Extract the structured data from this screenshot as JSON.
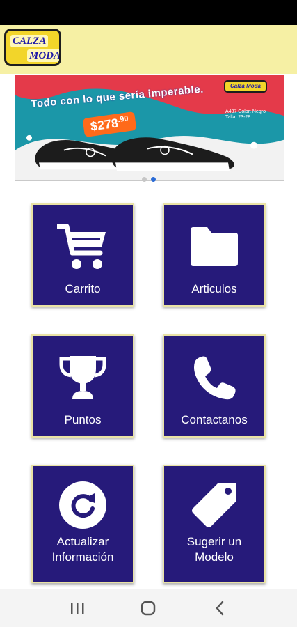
{
  "header": {
    "logo_line1": "CALZA",
    "logo_line2": "MODA"
  },
  "banner": {
    "headline": "Todo con lo que sería imperable.",
    "price_prefix": "Desde",
    "price": "$278",
    "price_cents": ".90",
    "mini_logo": "Calza Moda",
    "specs": "A437 Color: Negro Talla: 23-28",
    "slide_count": 2,
    "active_slide": 2
  },
  "tiles": [
    {
      "label": "Carrito",
      "icon": "cart-icon"
    },
    {
      "label": "Articulos",
      "icon": "folder-icon"
    },
    {
      "label": "Puntos",
      "icon": "trophy-icon"
    },
    {
      "label": "Contactanos",
      "icon": "phone-icon"
    },
    {
      "label": "Actualizar Información",
      "label_line1": "Actualizar",
      "label_line2": "Información",
      "icon": "refresh-icon"
    },
    {
      "label": "Sugerir un Modelo",
      "label_line1": "Sugerir un",
      "label_line2": "Modelo",
      "icon": "tag-icon"
    }
  ],
  "nav": {
    "recents": "recents-icon",
    "home": "home-icon",
    "back": "back-icon"
  },
  "colors": {
    "header_bg": "#f6f0a4",
    "tile_bg": "#261a7a",
    "tile_border": "#e9e2a5",
    "accent": "#2a6bd6"
  }
}
